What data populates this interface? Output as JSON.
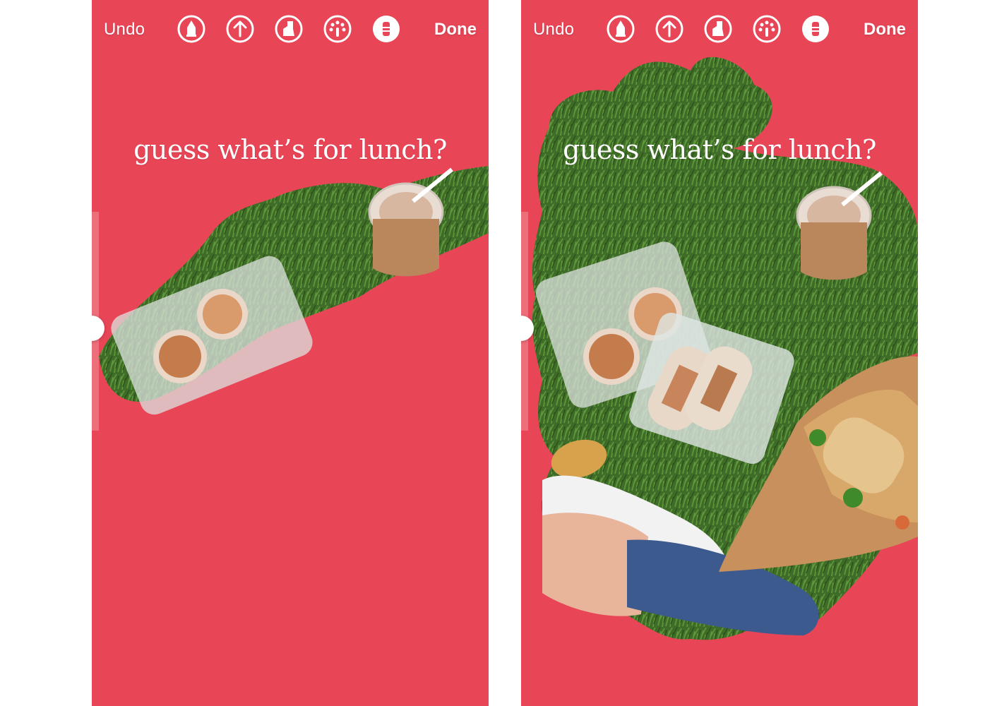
{
  "colors": {
    "background": "#e84657",
    "text": "#ffffff",
    "grass": "#3e6b28"
  },
  "screens": [
    {
      "toolbar": {
        "undo_label": "Undo",
        "done_label": "Done",
        "tools": [
          "marker-pen-icon",
          "arrow-pen-icon",
          "highlighter-icon",
          "color-palette-icon",
          "eraser-icon"
        ]
      },
      "caption": "guess what’s for lunch?",
      "slider_icon": "brush-size-slider"
    },
    {
      "toolbar": {
        "undo_label": "Undo",
        "done_label": "Done",
        "tools": [
          "marker-pen-icon",
          "arrow-pen-icon",
          "highlighter-icon",
          "color-palette-icon",
          "eraser-icon"
        ]
      },
      "caption": "guess what’s for lunch?",
      "slider_icon": "brush-size-slider"
    }
  ]
}
